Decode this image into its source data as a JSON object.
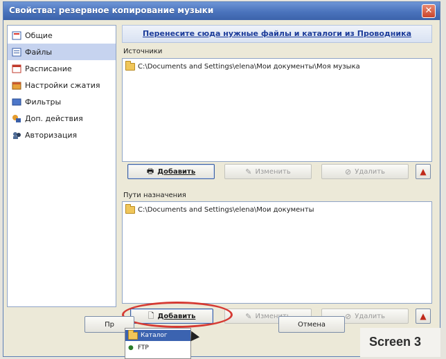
{
  "window": {
    "title": "Свойства: резервное копирование музыки"
  },
  "sidebar": {
    "items": [
      {
        "label": "Общие",
        "icon": "general-icon"
      },
      {
        "label": "Файлы",
        "icon": "files-icon"
      },
      {
        "label": "Расписание",
        "icon": "schedule-icon"
      },
      {
        "label": "Настройки сжатия",
        "icon": "compression-icon"
      },
      {
        "label": "Фильтры",
        "icon": "filter-icon"
      },
      {
        "label": "Доп. действия",
        "icon": "actions-icon"
      },
      {
        "label": "Авторизация",
        "icon": "authorization-icon"
      }
    ],
    "active_index": 1
  },
  "main": {
    "drag_hint": "Перенесите сюда нужные файлы и каталоги из Проводника",
    "sources": {
      "label": "Источники",
      "items": [
        "C:\\Documents and Settings\\elena\\Мои документы\\Моя музыка"
      ],
      "add": "Добавить",
      "edit": "Изменить",
      "delete": "Удалить"
    },
    "destinations": {
      "label": "Пути назначения",
      "items": [
        "C:\\Documents and Settings\\elena\\Мои документы"
      ],
      "add": "Добавить",
      "edit": "Изменить",
      "delete": "Удалить"
    }
  },
  "dropdown": {
    "items": [
      "Каталог",
      "FTP"
    ]
  },
  "footer": {
    "ok_label": "Пр",
    "cancel_label": "Отмена"
  },
  "caption": "Screen 3",
  "colors": {
    "titlebar": "#4a73bc",
    "highlight_ring": "#d53a33",
    "selection": "#3b63b0"
  }
}
